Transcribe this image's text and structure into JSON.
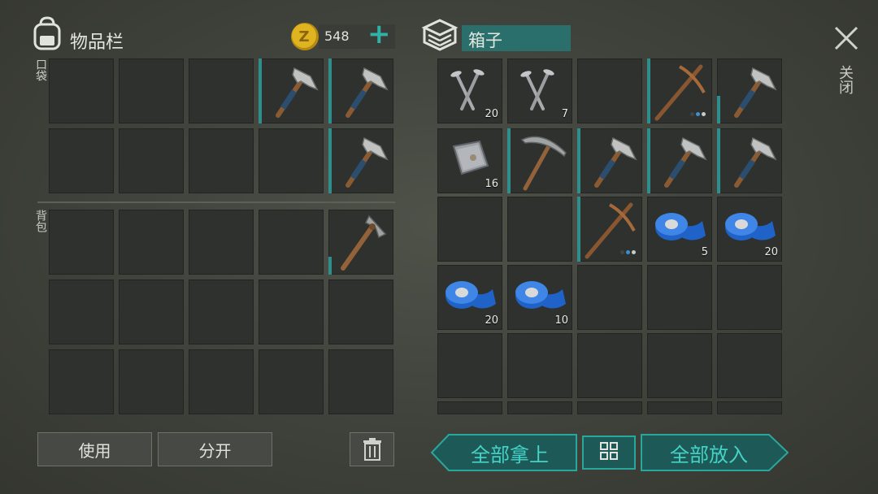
{
  "inventory": {
    "title": "物品栏",
    "currency_amount": "548",
    "add_label": "+",
    "section_pocket": "口袋",
    "section_backpack": "背包"
  },
  "box": {
    "title": "箱子",
    "close_label": "关闭",
    "quantities": {
      "nails_1": "20",
      "nails_2": "7",
      "metal_plate": "16",
      "tape_1": "5",
      "tape_2": "20",
      "tape_3": "20",
      "tape_4": "10"
    }
  },
  "buttons": {
    "use": "使用",
    "split": "分开",
    "take_all": "全部拿上",
    "put_all": "全部放入"
  },
  "colors": {
    "accent_teal": "#2aa79d",
    "durability_bar": "#2f8d8b",
    "tape_blue": "#1f63c9",
    "coin_gold": "#e0b321"
  }
}
